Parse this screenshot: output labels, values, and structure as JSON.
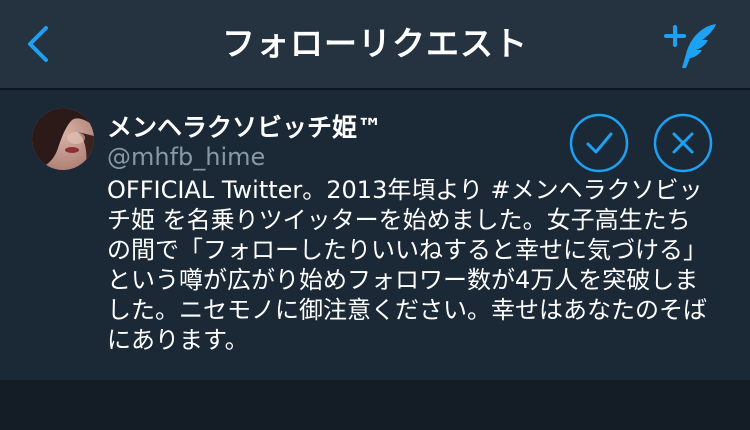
{
  "nav": {
    "title": "フォローリクエスト",
    "back_icon": "chevron-left-icon",
    "compose_icon": "compose-tweet-icon"
  },
  "request": {
    "display_name": "メンヘラクソビッチ姫™",
    "handle": "@mhfb_hime",
    "bio_lines": [
      "OFFICIAL Twitter。2013年頃より #メンヘラクソビッ",
      "チ姫 を名乗りツイッターを始めました。女子高生たち",
      "の間で「フォローしたりいいねすると幸せに気づける」",
      "という噂が広がり始めフォロワー数が4万人を突破しま",
      "した。ニセモノに御注意ください。幸せはあなたのそば",
      "にあります。"
    ],
    "accept_icon": "checkmark-icon",
    "decline_icon": "close-icon"
  },
  "colors": {
    "accent": "#1da1f2",
    "navbar_bg": "#253341",
    "card_bg": "#1b2836",
    "background": "#141d26",
    "secondary_text": "#8899a6"
  }
}
